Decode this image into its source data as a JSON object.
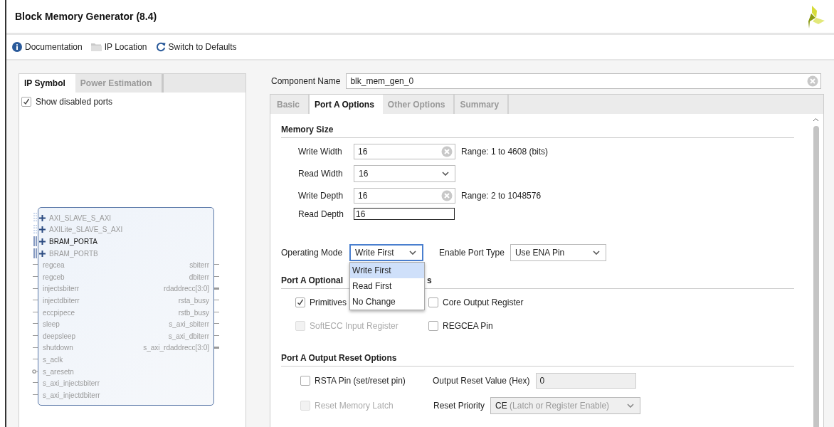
{
  "window": {
    "title": "Block Memory Generator (8.4)"
  },
  "toolbar": [
    {
      "kind": "info",
      "label": "Documentation"
    },
    {
      "kind": "folder",
      "label": "IP Location"
    },
    {
      "kind": "refresh",
      "label": "Switch to Defaults"
    }
  ],
  "left_panel": {
    "tabs": [
      {
        "label": "IP Symbol",
        "selected": true
      },
      {
        "label": "Power Estimation",
        "selected": false
      }
    ],
    "show_disabled_ports": {
      "label": "Show disabled ports",
      "checked": true
    },
    "symbol": {
      "interfaces": [
        {
          "name": "AXI_SLAVE_S_AXI",
          "kind": "axi",
          "enabled": false
        },
        {
          "name": "AXILite_SLAVE_S_AXI",
          "kind": "axi",
          "enabled": false
        },
        {
          "name": "BRAM_PORTA",
          "kind": "bram",
          "enabled": true
        },
        {
          "name": "BRAM_PORTB",
          "kind": "bram",
          "enabled": false
        }
      ],
      "left_ports": [
        {
          "name": "regcea",
          "kind": "wire"
        },
        {
          "name": "regceb",
          "kind": "wire"
        },
        {
          "name": "injectsbiterr",
          "kind": "wire"
        },
        {
          "name": "injectdbiterr",
          "kind": "wire"
        },
        {
          "name": "eccpipece",
          "kind": "wire"
        },
        {
          "name": "sleep",
          "kind": "wire"
        },
        {
          "name": "deepsleep",
          "kind": "wire"
        },
        {
          "name": "shutdown",
          "kind": "wire"
        },
        {
          "name": "s_aclk",
          "kind": "wire"
        },
        {
          "name": "s_aresetn",
          "kind": "inverted"
        },
        {
          "name": "s_axi_injectsbiterr",
          "kind": "wire"
        },
        {
          "name": "s_axi_injectdbiterr",
          "kind": "wire"
        }
      ],
      "right_ports": [
        {
          "name": "sbiterr",
          "kind": "wire"
        },
        {
          "name": "dbiterr",
          "kind": "wire"
        },
        {
          "name": "rdaddrecc[3:0]",
          "kind": "bus"
        },
        {
          "name": "rsta_busy",
          "kind": "wire"
        },
        {
          "name": "rstb_busy",
          "kind": "wire"
        },
        {
          "name": "s_axi_sbiterr",
          "kind": "wire"
        },
        {
          "name": "s_axi_dbiterr",
          "kind": "wire"
        },
        {
          "name": "s_axi_rdaddrecc[3:0]",
          "kind": "bus"
        }
      ]
    }
  },
  "component_name": {
    "label": "Component Name",
    "value": "blk_mem_gen_0"
  },
  "tabs": [
    {
      "label": "Basic",
      "selected": false
    },
    {
      "label": "Port A Options",
      "selected": true
    },
    {
      "label": "Other Options",
      "selected": false
    },
    {
      "label": "Summary",
      "selected": false
    }
  ],
  "memory_size": {
    "title": "Memory Size",
    "rows": [
      {
        "label": "Write Width",
        "kind": "clearable",
        "value": "16",
        "range": "Range: 1 to 4608 (bits)"
      },
      {
        "label": "Read Width",
        "kind": "dropdown",
        "value": "16"
      },
      {
        "label": "Write Depth",
        "kind": "clearable",
        "value": "16",
        "range": "Range: 2 to 1048576"
      },
      {
        "label": "Read Depth",
        "kind": "plain",
        "value": "16"
      }
    ]
  },
  "operating_mode": {
    "label": "Operating Mode",
    "value": "Write First",
    "open": true,
    "options": [
      {
        "label": "Write First",
        "selected": true
      },
      {
        "label": "Read First",
        "selected": false
      },
      {
        "label": "No Change",
        "selected": false
      }
    ]
  },
  "enable_port_type": {
    "label": "Enable Port Type",
    "value": "Use ENA Pin"
  },
  "optional_registers": {
    "title": "Port A Optional",
    "title_tail": "s",
    "checkboxes": [
      {
        "label": "Primitives",
        "checked": true,
        "disabled": false
      },
      {
        "label": "Core Output Register",
        "checked": false,
        "disabled": false
      },
      {
        "label": "SoftECC Input Register",
        "checked": false,
        "disabled": true
      },
      {
        "label": "REGCEA Pin",
        "checked": false,
        "disabled": false
      }
    ]
  },
  "reset_options": {
    "title": "Port A Output Reset Options",
    "rsta_pin": {
      "label": "RSTA Pin (set/reset pin)",
      "checked": false,
      "disabled": false
    },
    "reset_value": {
      "label": "Output Reset Value (Hex)",
      "value": "0",
      "disabled": true
    },
    "reset_memory_latch": {
      "label": "Reset Memory Latch",
      "checked": false,
      "disabled": true
    },
    "reset_priority": {
      "label": "Reset Priority",
      "value": "CE",
      "value_note": "(Latch or Register Enable)",
      "disabled": true
    }
  }
}
